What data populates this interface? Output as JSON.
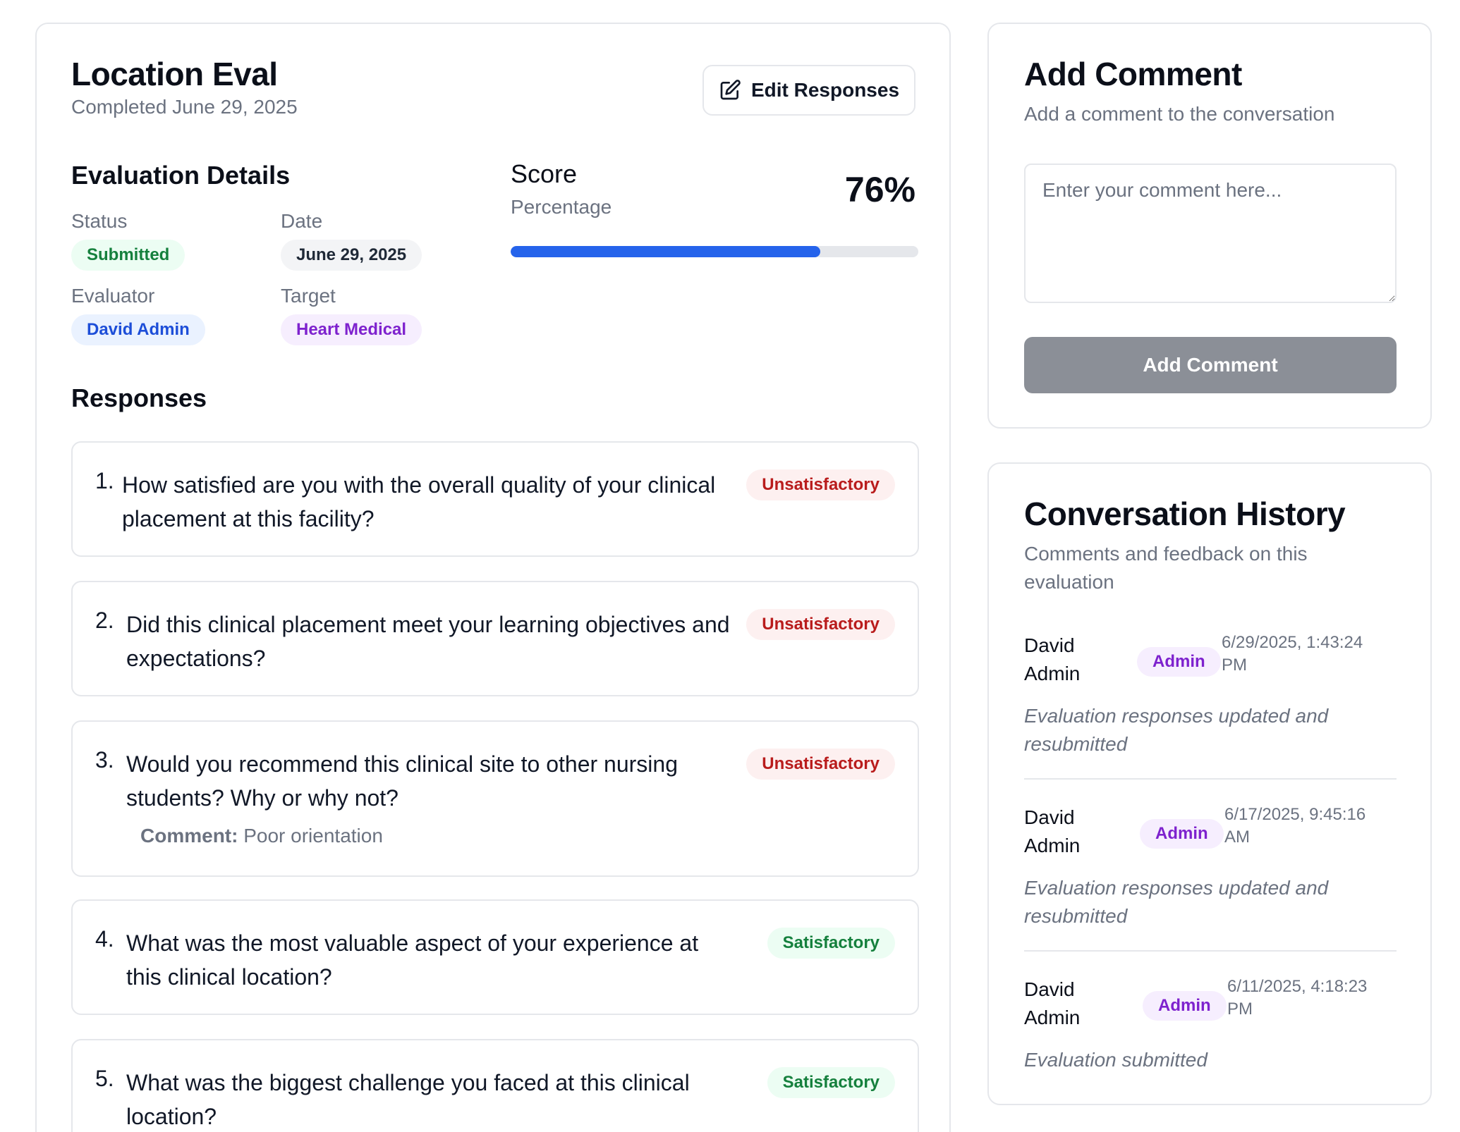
{
  "header": {
    "title": "Location Eval",
    "subtitle": "Completed June 29, 2025",
    "edit_label": "Edit Responses"
  },
  "details": {
    "title": "Evaluation Details",
    "status_label": "Status",
    "status_value": "Submitted",
    "date_label": "Date",
    "date_value": "June 29, 2025",
    "evaluator_label": "Evaluator",
    "evaluator_value": "David Admin",
    "target_label": "Target",
    "target_value": "Heart Medical"
  },
  "score": {
    "title": "Score",
    "subtitle": "Percentage",
    "value_text": "76%",
    "percent": 76
  },
  "responses": {
    "title": "Responses",
    "items": [
      {
        "num": "1.",
        "question": "How satisfied are you with the overall quality of your clinical placement at this facility?",
        "rating": "Unsatisfactory"
      },
      {
        "num": "2.",
        "question": "Did this clinical placement meet your learning objectives and expectations?",
        "rating": "Unsatisfactory"
      },
      {
        "num": "3.",
        "question": "Would you recommend this clinical site to other nursing students? Why or why not?",
        "rating": "Unsatisfactory",
        "comment_label": "Comment:",
        "comment": "Poor orientation"
      },
      {
        "num": "4.",
        "question": "What was the most valuable aspect of your experience at this clinical location?",
        "rating": "Satisfactory"
      },
      {
        "num": "5.",
        "question": "What was the biggest challenge you faced at this clinical location?",
        "rating": "Satisfactory"
      }
    ]
  },
  "add_comment": {
    "title": "Add Comment",
    "subtitle": "Add a comment to the conversation",
    "placeholder": "Enter your comment here...",
    "button_label": "Add Comment"
  },
  "history": {
    "title": "Conversation History",
    "subtitle": "Comments and feedback on this evaluation",
    "messages": [
      {
        "author": "David Admin",
        "role": "Admin",
        "time": "6/29/2025, 1:43:24 PM",
        "body": "Evaluation responses updated and resubmitted"
      },
      {
        "author": "David Admin",
        "role": "Admin",
        "time": "6/17/2025, 9:45:16 AM",
        "body": "Evaluation responses updated and resubmitted"
      },
      {
        "author": "David Admin",
        "role": "Admin",
        "time": "6/11/2025, 4:18:23 PM",
        "body": "Evaluation submitted"
      }
    ]
  },
  "colors": {
    "accent": "#2563eb",
    "success": "#15803d",
    "danger": "#b91c1c",
    "purple": "#7e22ce"
  },
  "icons": {
    "edit": "edit-icon"
  }
}
